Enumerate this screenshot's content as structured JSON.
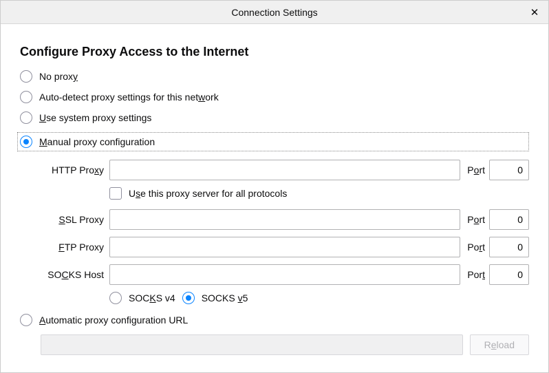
{
  "titlebar": {
    "title": "Connection Settings"
  },
  "heading": "Configure Proxy Access to the Internet",
  "options": {
    "no_proxy": "No proxy",
    "auto_detect": "Auto-detect proxy settings for this network",
    "system": "Use system proxy settings",
    "manual": "Manual proxy configuration",
    "auto_url": "Automatic proxy configuration URL"
  },
  "underline": {
    "no_proxy": "y",
    "auto_detect": "w",
    "system": "U",
    "manual": "M",
    "auto_url": "A"
  },
  "fields": {
    "http": {
      "label_a": "HTTP Pro",
      "label_u": "x",
      "label_b": "y",
      "value": "",
      "port_label_a": "P",
      "port_label_u": "o",
      "port_label_b": "rt",
      "port": "0"
    },
    "ssl": {
      "label_a": "",
      "label_u": "S",
      "label_b": "SL Proxy",
      "value": "",
      "port_label_a": "P",
      "port_label_u": "o",
      "port_label_b": "rt",
      "port": "0"
    },
    "ftp": {
      "label_a": "",
      "label_u": "F",
      "label_b": "TP Proxy",
      "value": "",
      "port_label_a": "Po",
      "port_label_u": "r",
      "port_label_b": "t",
      "port": "0"
    },
    "socks": {
      "label_a": "SO",
      "label_u": "C",
      "label_b": "KS Host",
      "value": "",
      "port_label_a": "Por",
      "port_label_u": "t",
      "port_label_b": "",
      "port": "0"
    }
  },
  "use_for_all": {
    "label_a": "U",
    "label_u": "s",
    "label_b": "e this proxy server for all protocols"
  },
  "socks_ver": {
    "v4": {
      "a": "SOC",
      "u": "K",
      "b": "S v4"
    },
    "v5": {
      "a": "SOCKS ",
      "u": "v",
      "b": "5"
    }
  },
  "reload_label": {
    "a": "R",
    "u": "e",
    "b": "load"
  }
}
